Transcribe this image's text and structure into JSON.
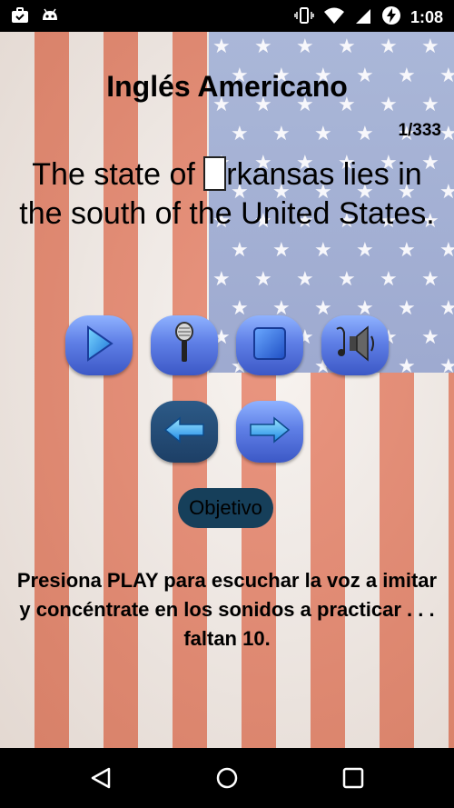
{
  "status_bar": {
    "time": "1:08",
    "icons": [
      "briefcase-check-icon",
      "android-icon",
      "vibrate-icon",
      "wifi-icon",
      "signal-icon",
      "battery-charging-icon"
    ]
  },
  "app": {
    "title": "Inglés Americano",
    "counter": "1/333",
    "sentence_before_gap": "The state of ",
    "sentence_after_gap": "rkansas lies in the south of the United States.",
    "objective_label": "Objetivo",
    "instruction": "Presiona PLAY para escuchar la voz a imitar y concéntrate en los sonidos a practicar . . . faltan 10."
  },
  "controls": [
    "play-icon",
    "microphone-icon",
    "stop-icon",
    "speaker-icon"
  ],
  "navigation": [
    "arrow-left-icon",
    "arrow-right-icon"
  ],
  "nav_bar": [
    "back-icon",
    "home-icon",
    "recents-icon"
  ],
  "colors": {
    "stripe_red": "#f0876d",
    "stripe_white": "#f7f2ee",
    "canton_blue": "#a3b0d4",
    "button_blue": "#5f7fe6",
    "objective_bg": "#163f5a"
  }
}
